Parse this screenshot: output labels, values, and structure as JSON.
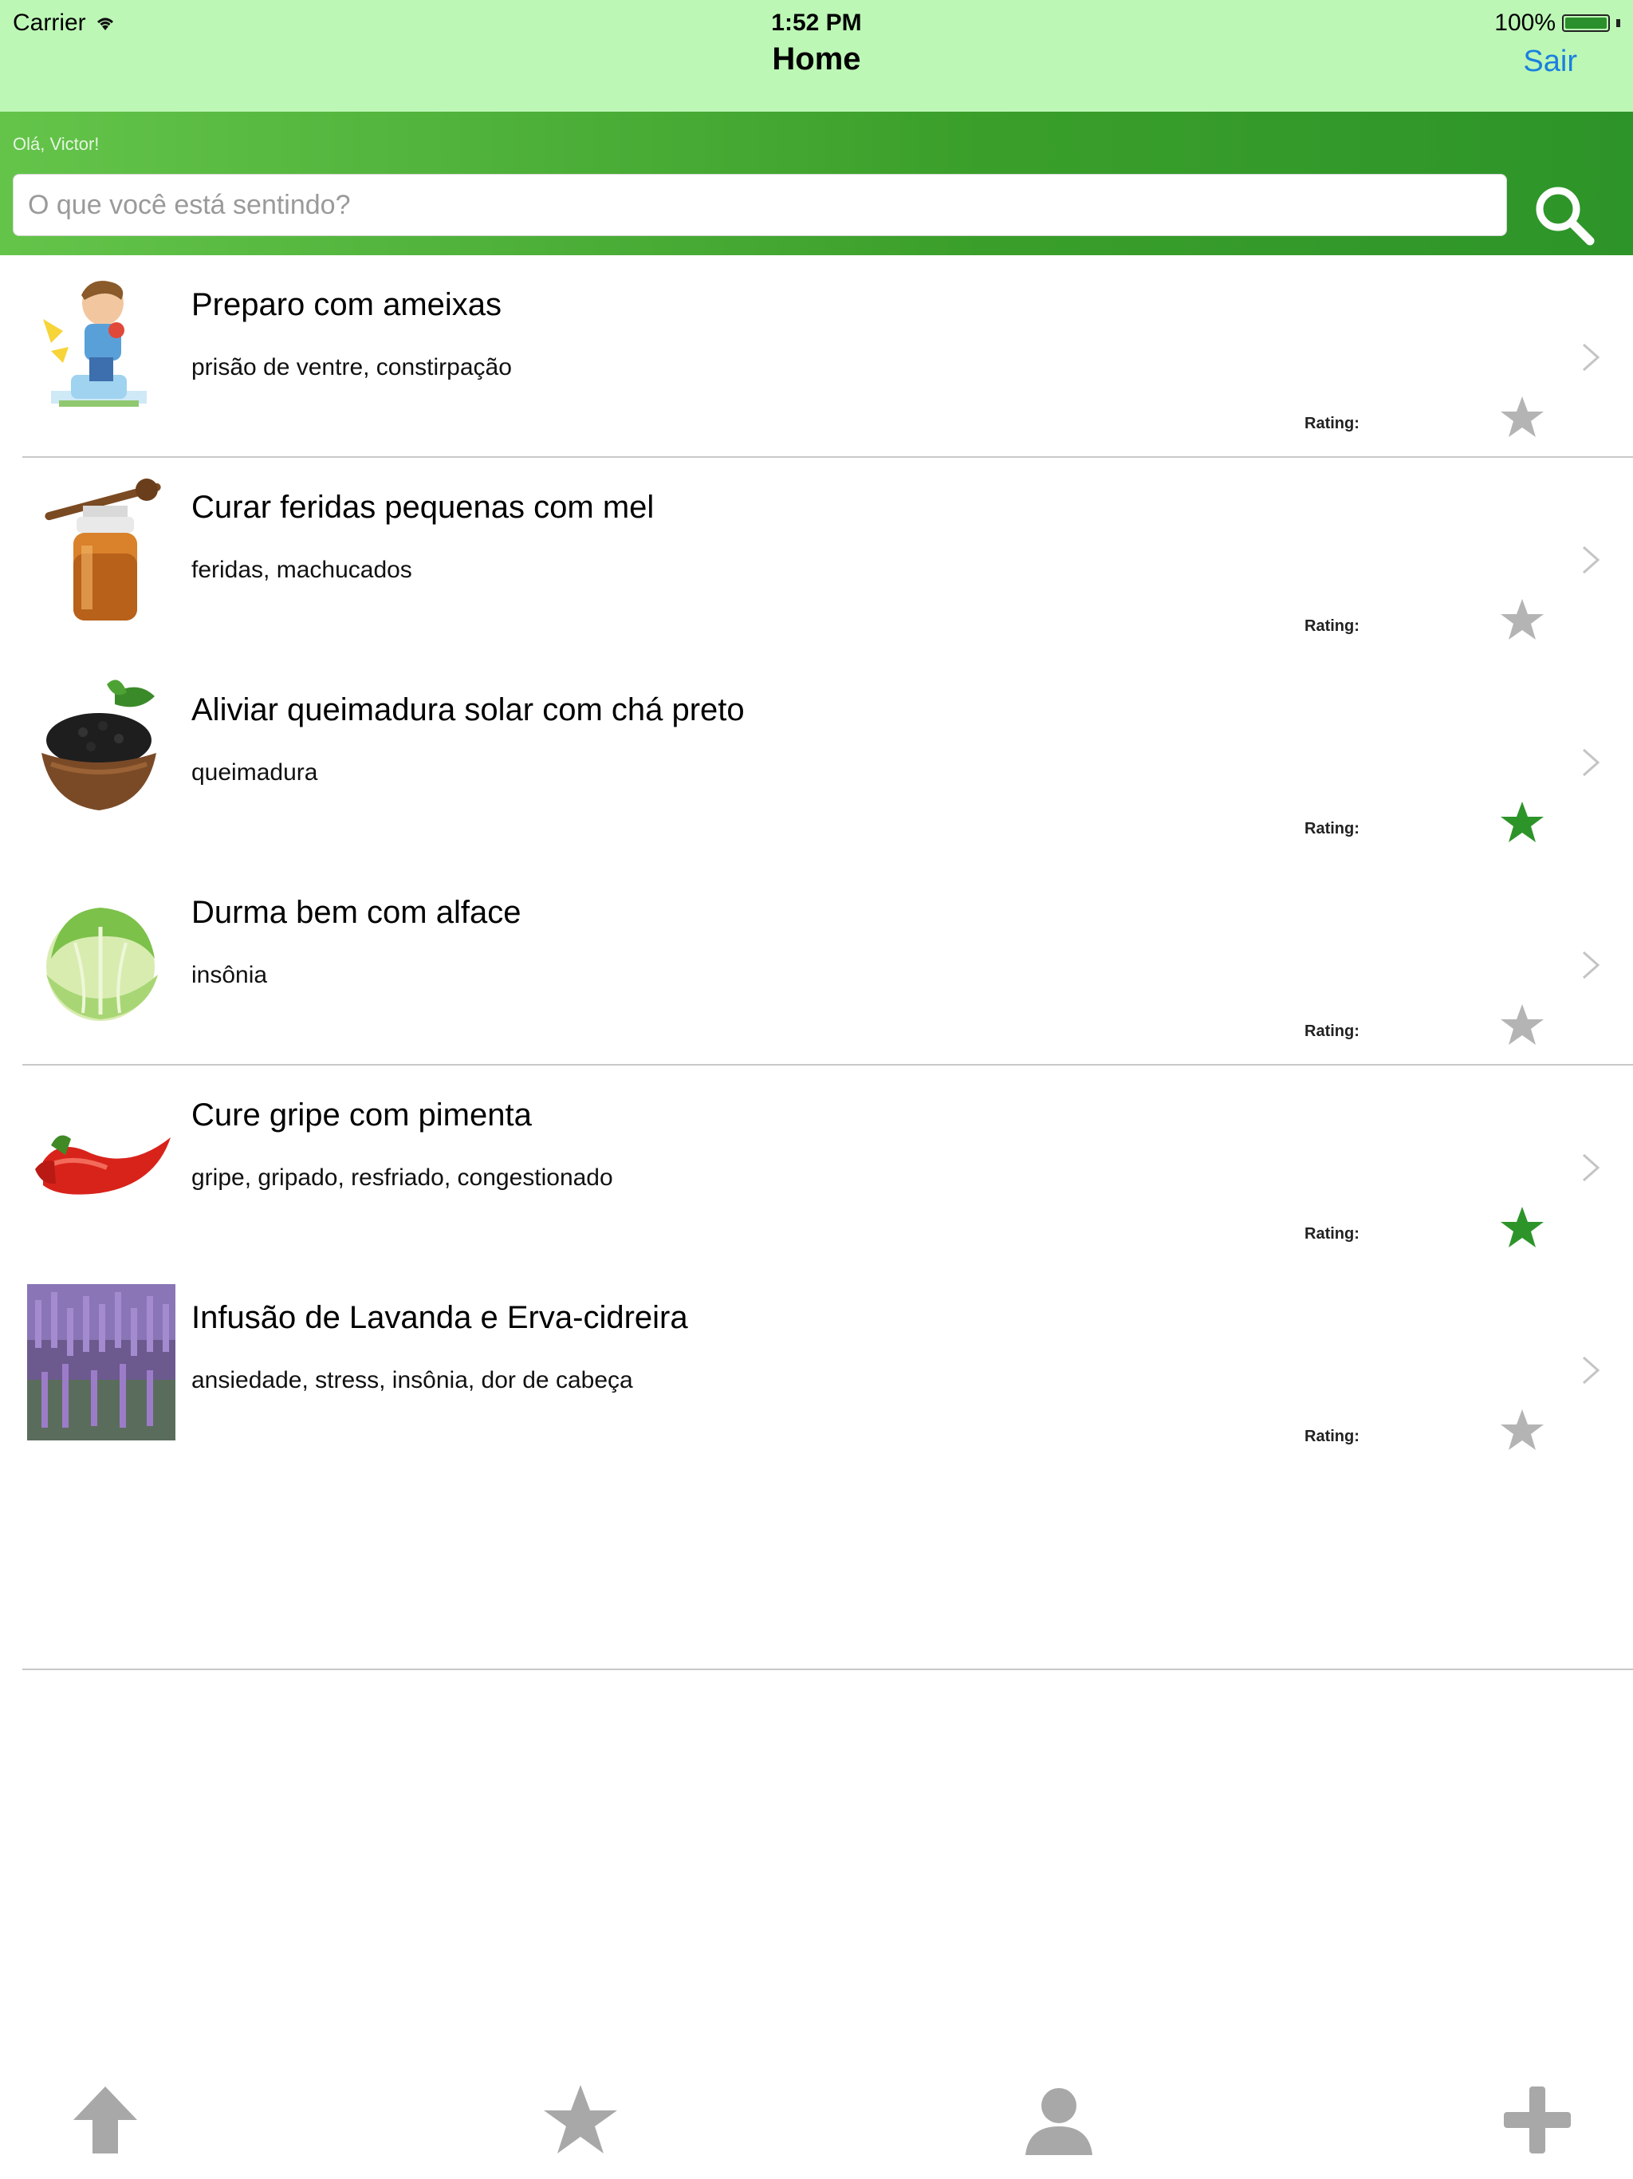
{
  "status": {
    "carrier": "Carrier",
    "time": "1:52 PM",
    "battery": "100%"
  },
  "nav": {
    "title": "Home",
    "right_button": "Sair"
  },
  "header": {
    "greeting": "Olá, Victor!",
    "search_placeholder": "O que você está sentindo?"
  },
  "colors": {
    "nav_bg": "#bdf7b6",
    "header_green": "#3a9f2a",
    "star_active": "#2d9429",
    "star_inactive": "#b4b4b4",
    "link": "#1a7fe0"
  },
  "items": [
    {
      "title": "Preparo com ameixas",
      "tags": "prisão de ventre, constirpação",
      "rating_label": "Rating:",
      "rated": false,
      "image": "boy-toilet-cartoon"
    },
    {
      "title": "Curar feridas pequenas com mel",
      "tags": "feridas, machucados",
      "rating_label": "Rating:",
      "rated": false,
      "image": "honey-jar"
    },
    {
      "title": "Aliviar queimadura solar com chá preto",
      "tags": "queimadura",
      "rating_label": "Rating:",
      "rated": true,
      "image": "black-tea-bowl"
    },
    {
      "title": "Durma bem com alface",
      "tags": "insônia",
      "rating_label": "Rating:",
      "rated": false,
      "image": "lettuce"
    },
    {
      "title": "Cure gripe com pimenta",
      "tags": "gripe, gripado, resfriado, congestionado",
      "rating_label": "Rating:",
      "rated": true,
      "image": "red-pepper"
    },
    {
      "title": "Infusão de Lavanda e Erva-cidreira",
      "tags": "ansiedade, stress, insônia, dor de cabeça",
      "rating_label": "Rating:",
      "rated": false,
      "image": "lavender-field"
    }
  ],
  "tabs": [
    {
      "icon": "arrow-up-icon"
    },
    {
      "icon": "star-icon"
    },
    {
      "icon": "person-icon"
    },
    {
      "icon": "plus-icon"
    }
  ]
}
